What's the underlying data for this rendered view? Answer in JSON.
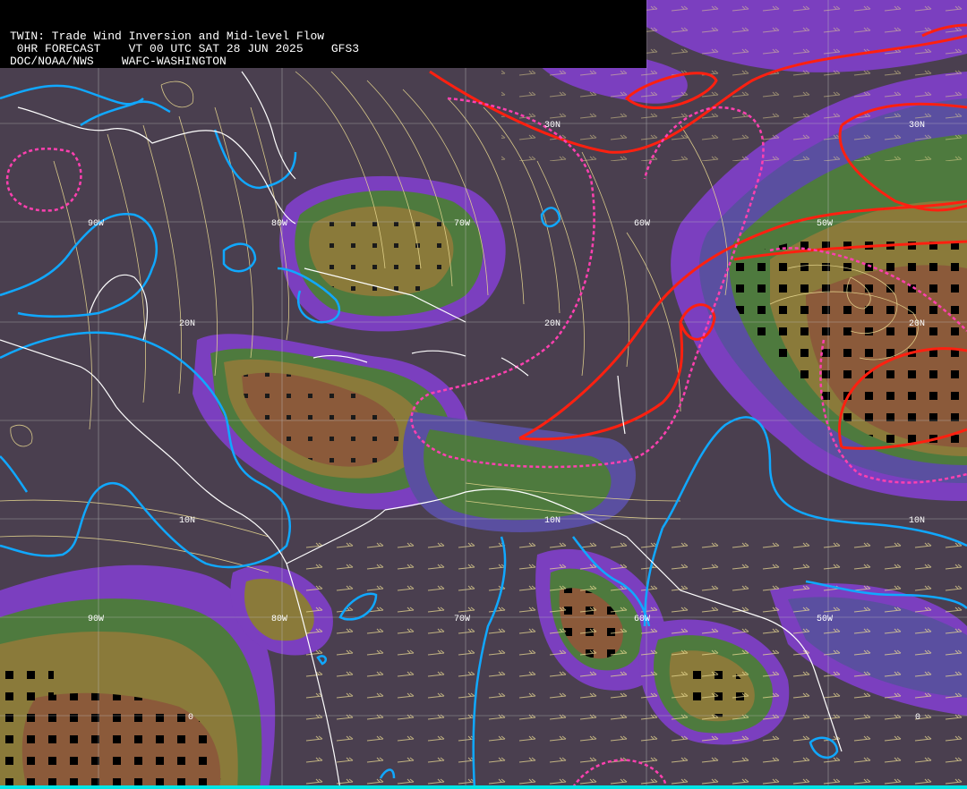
{
  "header": {
    "line1": "TWIN: Trade Wind Inversion and Mid-level Flow",
    "line2": " 0HR FORECAST    VT 00 UTC SAT 28 JUN 2025    GFS3",
    "line3": "DOC/NOAA/NWS    WAFC-WASHINGTON"
  },
  "map": {
    "latitude_labels": [
      "30N",
      "30N",
      "20N",
      "20N",
      "20N",
      "10N",
      "10N",
      "10N",
      "0",
      "0"
    ],
    "longitude_labels": [
      "90W",
      "80W",
      "70W",
      "60W",
      "50W",
      "90W",
      "80W",
      "70W",
      "60W",
      "50W"
    ],
    "colors": {
      "background": "#4a3f4f",
      "purple": "#7b3fbf",
      "blue_purple": "#5a4fa0",
      "green": "#4e7a3e",
      "olive": "#8a7a3a",
      "brown": "#8b5a3a",
      "red_contour": "#ff2010",
      "pink_dashed": "#ff40b0",
      "blue_contour": "#10a8ff",
      "streamline": "#e8d890",
      "coastline": "#ffffff",
      "grid": "#cfcfcf"
    }
  }
}
